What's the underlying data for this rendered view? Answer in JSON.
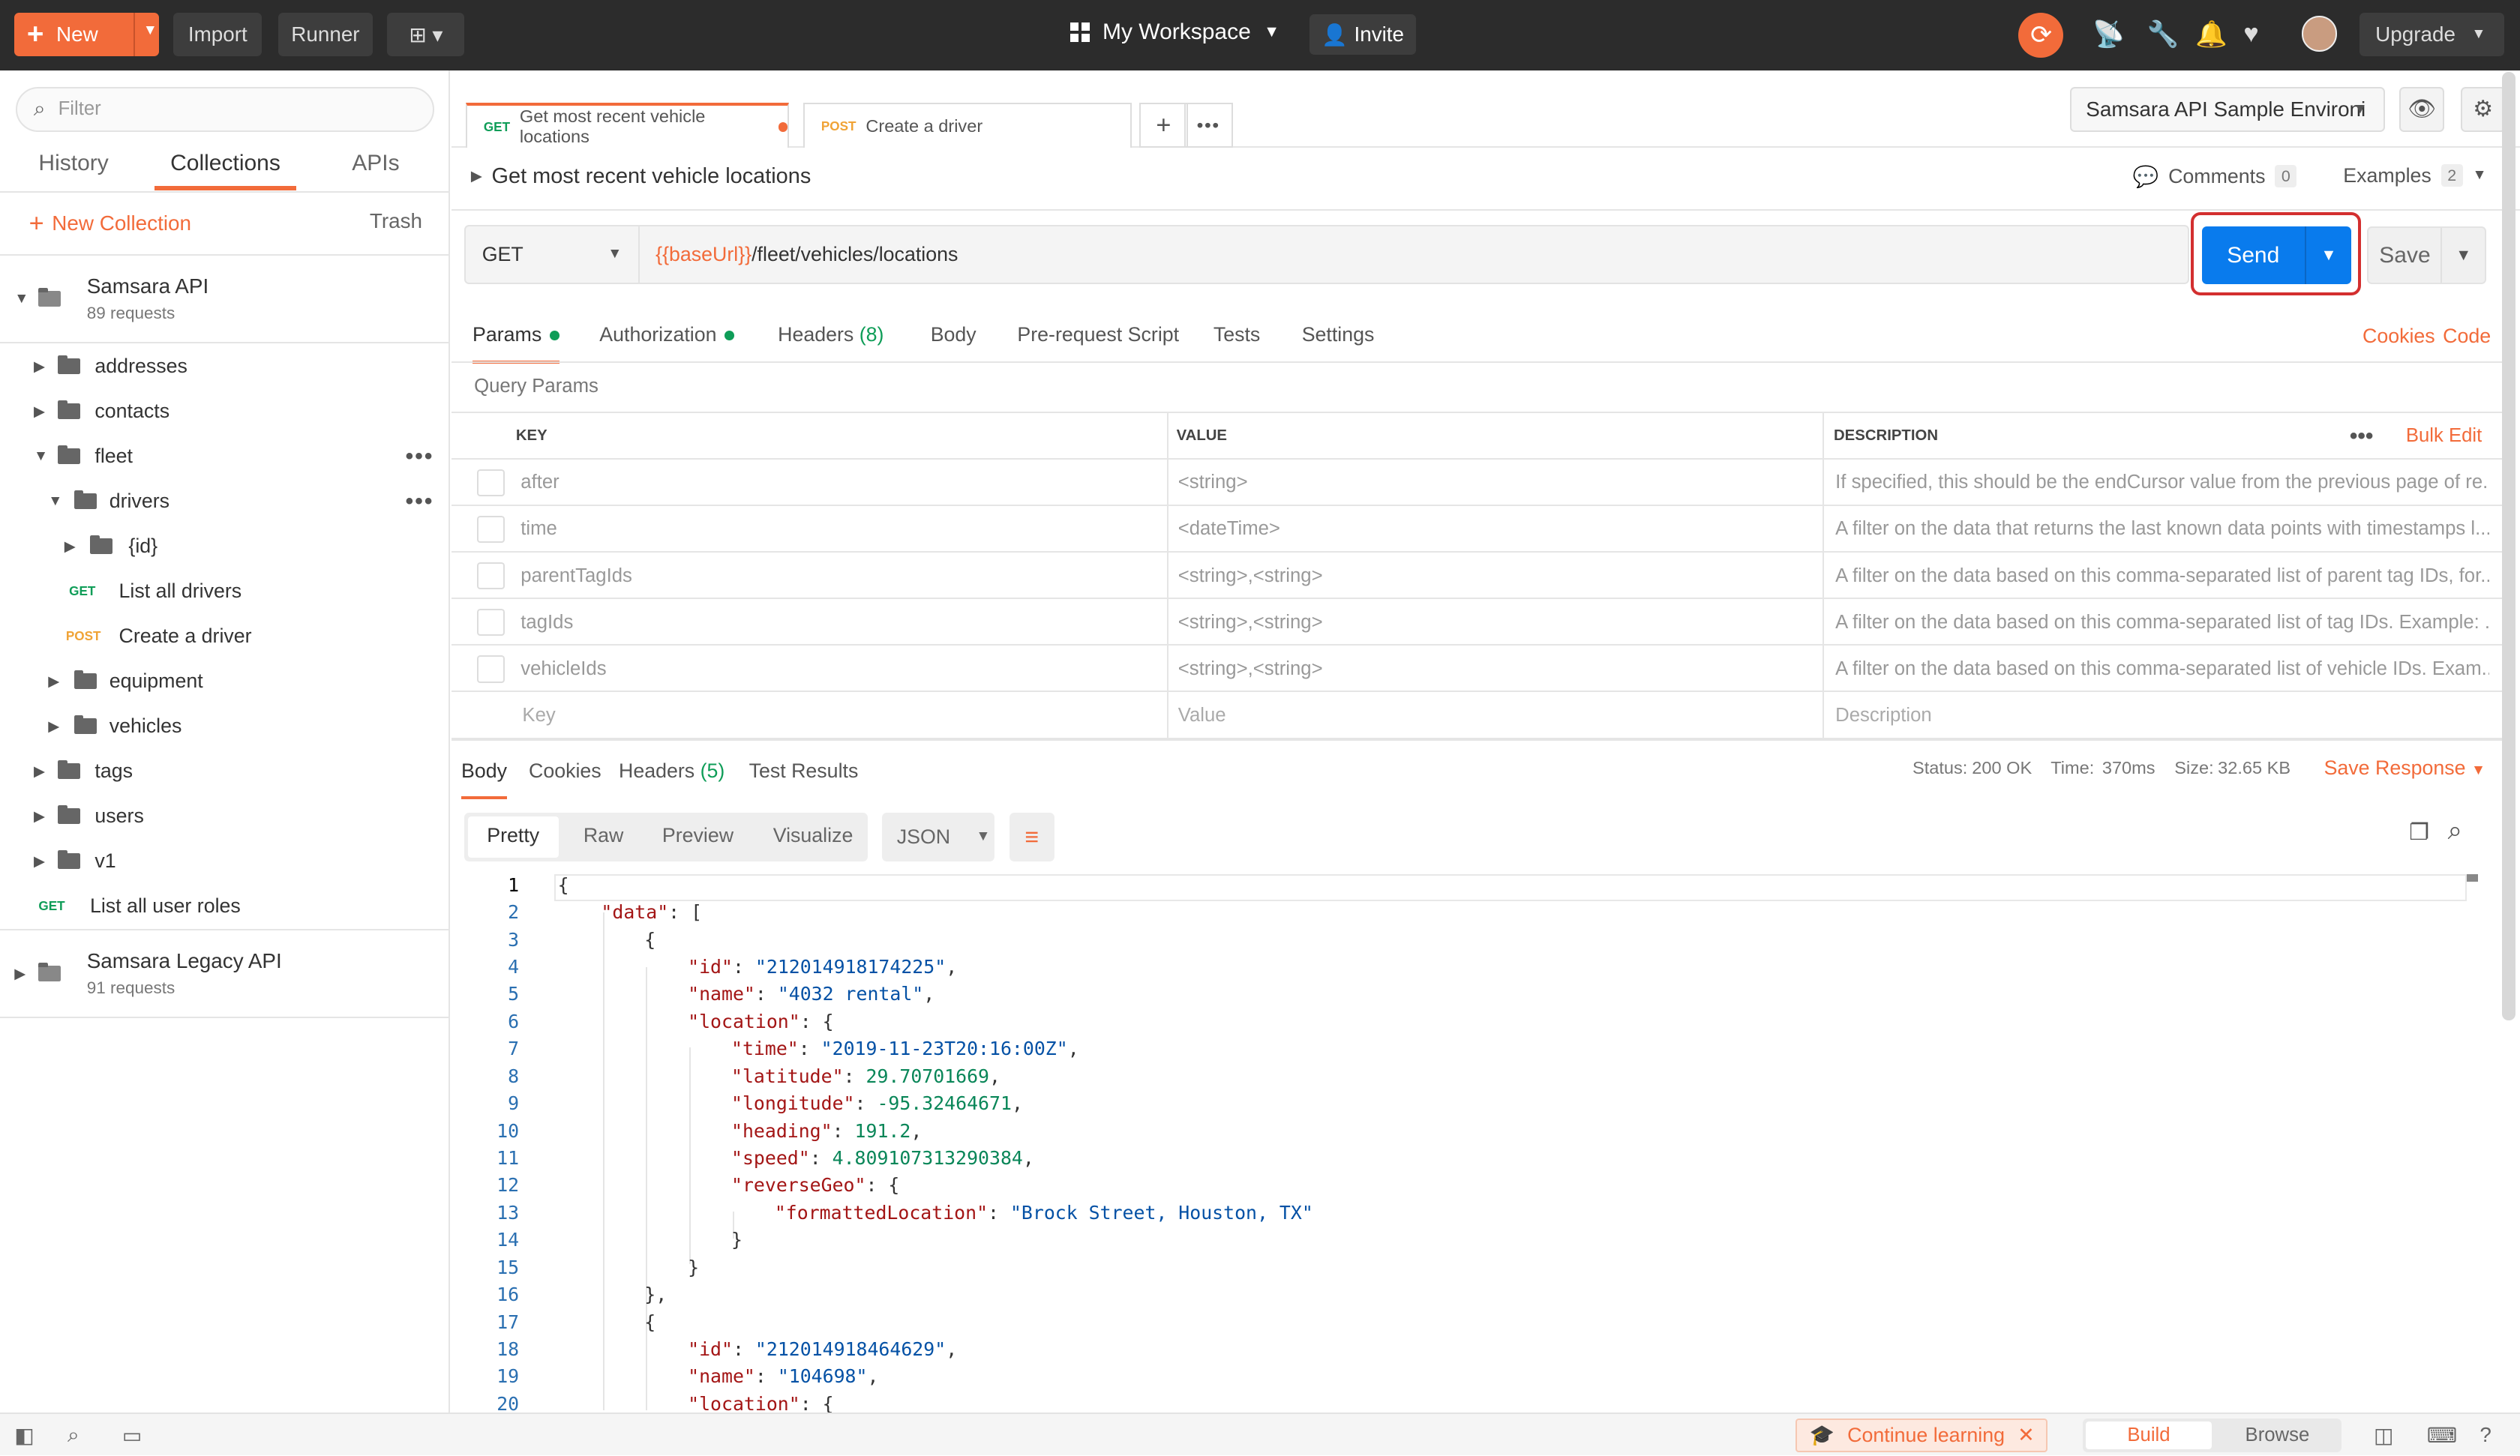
{
  "topbar": {
    "new_label": "New",
    "import_label": "Import",
    "runner_label": "Runner",
    "workspace_label": "My Workspace",
    "invite_label": "Invite",
    "upgrade_label": "Upgrade"
  },
  "sidebar": {
    "filter_placeholder": "Filter",
    "tabs": [
      "History",
      "Collections",
      "APIs"
    ],
    "active_tab": "Collections",
    "new_collection_label": "New Collection",
    "trash_label": "Trash",
    "collections": [
      {
        "name": "Samsara API",
        "count": "89 requests"
      },
      {
        "name": "Samsara Legacy API",
        "count": "91 requests"
      }
    ],
    "tree": {
      "addresses": "addresses",
      "contacts": "contacts",
      "fleet": "fleet",
      "drivers": "drivers",
      "id": "{id}",
      "list_all_drivers": {
        "method": "GET",
        "label": "List all drivers"
      },
      "create_driver": {
        "method": "POST",
        "label": "Create a driver"
      },
      "equipment": "equipment",
      "vehicles": "vehicles",
      "tags": "tags",
      "users": "users",
      "v1": "v1",
      "list_user_roles": {
        "method": "GET",
        "label": "List all user roles"
      }
    }
  },
  "tabs": [
    {
      "method": "GET",
      "label": "Get most recent vehicle locations"
    },
    {
      "method": "POST",
      "label": "Create a driver"
    }
  ],
  "environment": "Samsara API Sample Environi",
  "request": {
    "title": "Get most recent vehicle locations",
    "comments_label": "Comments",
    "comments_count": "0",
    "examples_label": "Examples",
    "examples_count": "2",
    "method": "GET",
    "url_var": "{{baseUrl}}",
    "url_path": "/fleet/vehicles/locations",
    "send_label": "Send",
    "save_label": "Save"
  },
  "request_tabs": {
    "params": "Params",
    "authorization": "Authorization",
    "headers": "Headers",
    "headers_count": "(8)",
    "body": "Body",
    "prerequest": "Pre-request Script",
    "tests": "Tests",
    "settings": "Settings",
    "cookies": "Cookies",
    "code": "Code"
  },
  "query_params": {
    "title": "Query Params",
    "col_key": "KEY",
    "col_value": "VALUE",
    "col_desc": "DESCRIPTION",
    "bulk_edit": "Bulk Edit",
    "rows": [
      {
        "key": "after",
        "value": "<string>",
        "desc": "If specified, this should be the endCursor value from the previous page of re..."
      },
      {
        "key": "time",
        "value": "<dateTime>",
        "desc": "A filter on the data that returns the last known data points with timestamps l..."
      },
      {
        "key": "parentTagIds",
        "value": "<string>,<string>",
        "desc": "A filter on the data based on this comma-separated list of parent tag IDs, for..."
      },
      {
        "key": "tagIds",
        "value": "<string>,<string>",
        "desc": "A filter on the data based on this comma-separated list of tag IDs. Example: ..."
      },
      {
        "key": "vehicleIds",
        "value": "<string>,<string>",
        "desc": "A filter on the data based on this comma-separated list of vehicle IDs. Exam..."
      }
    ],
    "placeholder": {
      "key": "Key",
      "value": "Value",
      "desc": "Description"
    }
  },
  "response": {
    "tabs": {
      "body": "Body",
      "cookies": "Cookies",
      "headers": "Headers",
      "headers_count": "(5)",
      "tests": "Test Results"
    },
    "status_label": "Status:",
    "status_value": "200 OK",
    "time_label": "Time:",
    "time_value": "370ms",
    "size_label": "Size:",
    "size_value": "32.65 KB",
    "save_response": "Save Response",
    "formats": [
      "Pretty",
      "Raw",
      "Preview",
      "Visualize"
    ],
    "active_format": "Pretty",
    "language": "JSON",
    "lines": [
      "1",
      "2",
      "3",
      "4",
      "5",
      "6",
      "7",
      "8",
      "9",
      "10",
      "11",
      "12",
      "13",
      "14",
      "15",
      "16",
      "17",
      "18",
      "19",
      "20"
    ],
    "json": {
      "open": "{",
      "data_key": "\"data\"",
      "id1": "\"212014918174225\"",
      "name1": "\"4032 rental\"",
      "time_v": "\"2019-11-23T20:16:00Z\"",
      "lat_v": "29.70701669",
      "lon_v": "-95.32464671",
      "head_v": "191.2",
      "speed_v": "4.809107313290384",
      "loc_v": "\"Brock Street, Houston, TX\"",
      "id2": "\"212014918464629\"",
      "name2": "\"104698\""
    }
  },
  "statusbar": {
    "continue_learning": "Continue learning",
    "build": "Build",
    "browse": "Browse"
  }
}
